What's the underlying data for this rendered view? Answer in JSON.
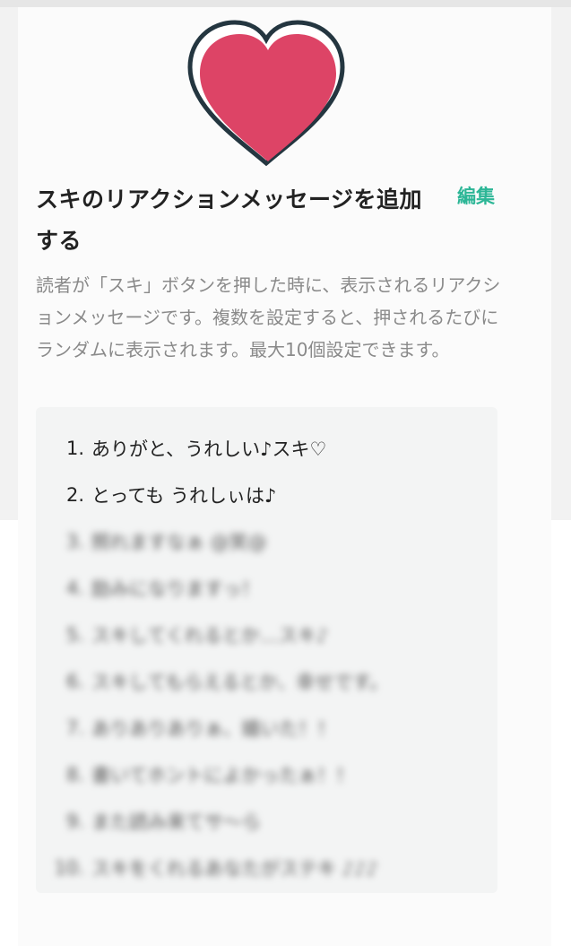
{
  "header": {
    "title": "スキのリアクションメッセージを追加する",
    "edit_label": "編集"
  },
  "description": "読者が「スキ」ボタンを押した時に、表示されるリアクションメッセージです。複数を設定すると、押されるたびにランダムに表示されます。最大10個設定できます。",
  "messages": [
    {
      "num": "1.",
      "text": "ありがと、うれしい♪スキ♡"
    },
    {
      "num": "2.",
      "text": "とっても うれしぃは♪"
    },
    {
      "num": "3.",
      "text": "照れますなぁ @笑@"
    },
    {
      "num": "4.",
      "text": "励みになりますっ！"
    },
    {
      "num": "5.",
      "text": "スキしてくれるとか…スキ♪"
    },
    {
      "num": "6.",
      "text": "スキしてもらえるとか、幸せです。"
    },
    {
      "num": "7.",
      "text": "ありありありぁ、嬉いた！！"
    },
    {
      "num": "8.",
      "text": "書いてホントによかったぁ！！"
    },
    {
      "num": "9.",
      "text": "また読み来てサ～ら"
    },
    {
      "num": "10.",
      "text": "スキをくれるあなたがステキ ♪♪♪"
    }
  ],
  "colors": {
    "accent": "#2cb696",
    "heart_fill": "#dd4466",
    "heart_outline": "#243640"
  },
  "icons": {
    "heart": "heart-icon"
  }
}
